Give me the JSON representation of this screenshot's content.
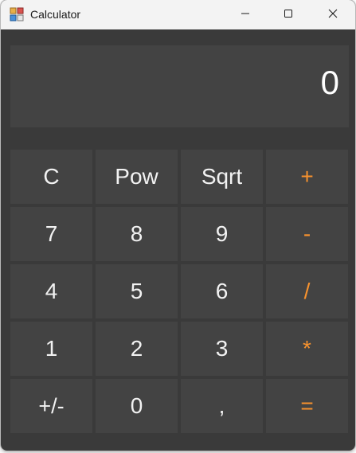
{
  "window": {
    "title": "Calculator",
    "icon": "calculator-app-icon",
    "controls": [
      "minimize-icon",
      "maximize-icon",
      "close-icon"
    ]
  },
  "display": {
    "value": "0"
  },
  "colors": {
    "background": "#3a3a3a",
    "panel": "#434343",
    "text": "#f2f2f2",
    "operator": "#f7922e",
    "titlebar": "#f3f3f3"
  },
  "keys": {
    "clear": "C",
    "pow": "Pow",
    "sqrt": "Sqrt",
    "add": "+",
    "seven": "7",
    "eight": "8",
    "nine": "9",
    "subtract": "-",
    "four": "4",
    "five": "5",
    "six": "6",
    "divide": "/",
    "one": "1",
    "two": "2",
    "three": "3",
    "multiply": "*",
    "negate": "+/-",
    "zero": "0",
    "decimal": ",",
    "equals": "="
  }
}
